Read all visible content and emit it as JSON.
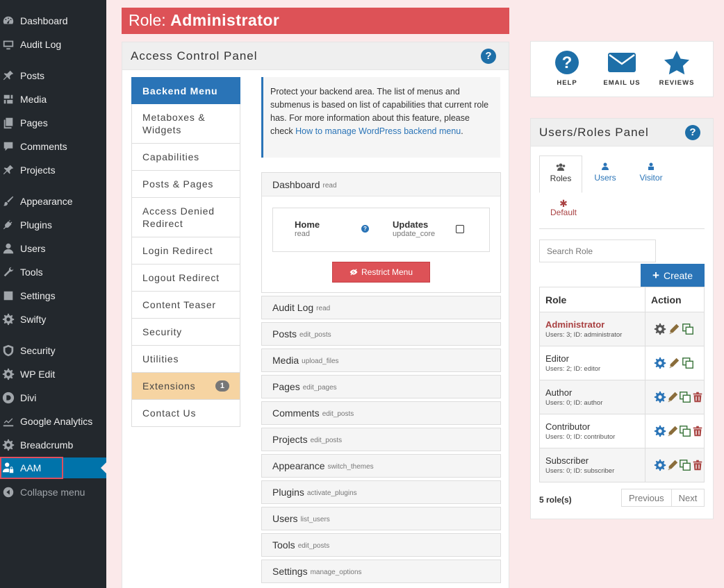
{
  "sidebar": {
    "items": [
      {
        "label": "Dashboard",
        "icon": "dashboard-icon"
      },
      {
        "label": "Audit Log",
        "icon": "monitor-icon"
      },
      {
        "label": "Posts",
        "icon": "pin-icon"
      },
      {
        "label": "Media",
        "icon": "media-icon"
      },
      {
        "label": "Pages",
        "icon": "pages-icon"
      },
      {
        "label": "Comments",
        "icon": "comment-icon"
      },
      {
        "label": "Projects",
        "icon": "pin-icon"
      },
      {
        "label": "Appearance",
        "icon": "brush-icon"
      },
      {
        "label": "Plugins",
        "icon": "plug-icon"
      },
      {
        "label": "Users",
        "icon": "user-icon"
      },
      {
        "label": "Tools",
        "icon": "wrench-icon"
      },
      {
        "label": "Settings",
        "icon": "settings-icon"
      },
      {
        "label": "Swifty",
        "icon": "gear-icon"
      },
      {
        "label": "Security",
        "icon": "shield-icon"
      },
      {
        "label": "WP Edit",
        "icon": "gear-icon"
      },
      {
        "label": "Divi",
        "icon": "divi-icon"
      },
      {
        "label": "Google Analytics",
        "icon": "chart-icon"
      },
      {
        "label": "Breadcrumb",
        "icon": "gear-icon"
      },
      {
        "label": "AAM",
        "icon": "user-lock-icon"
      },
      {
        "label": "Collapse menu",
        "icon": "collapse-icon"
      }
    ]
  },
  "role_header": {
    "prefix": "Role: ",
    "name": "Administrator"
  },
  "access_panel": {
    "title": "Access Control Panel",
    "features": [
      {
        "label": "Backend Menu"
      },
      {
        "label": "Metaboxes & Widgets"
      },
      {
        "label": "Capabilities"
      },
      {
        "label": "Posts & Pages"
      },
      {
        "label": "Access Denied Redirect"
      },
      {
        "label": "Login Redirect"
      },
      {
        "label": "Logout Redirect"
      },
      {
        "label": "Content Teaser"
      },
      {
        "label": "Security"
      },
      {
        "label": "Utilities"
      },
      {
        "label": "Extensions",
        "badge": "1"
      },
      {
        "label": "Contact Us"
      }
    ],
    "info_text": "Protect your backend area. The list of menus and submenus is based on list of capabilities that current role has. For more information about this feature, please check",
    "info_link": "How to manage WordPress backend menu",
    "info_end": ".",
    "menus": [
      {
        "name": "Dashboard",
        "cap": "read"
      },
      {
        "name": "Audit Log",
        "cap": "read"
      },
      {
        "name": "Posts",
        "cap": "edit_posts"
      },
      {
        "name": "Media",
        "cap": "upload_files"
      },
      {
        "name": "Pages",
        "cap": "edit_pages"
      },
      {
        "name": "Comments",
        "cap": "edit_posts"
      },
      {
        "name": "Projects",
        "cap": "edit_posts"
      },
      {
        "name": "Appearance",
        "cap": "switch_themes"
      },
      {
        "name": "Plugins",
        "cap": "activate_plugins"
      },
      {
        "name": "Users",
        "cap": "list_users"
      },
      {
        "name": "Tools",
        "cap": "edit_posts"
      },
      {
        "name": "Settings",
        "cap": "manage_options"
      }
    ],
    "submenus": [
      {
        "name": "Home",
        "cap": "read"
      },
      {
        "name": "Updates",
        "cap": "update_core"
      }
    ],
    "restrict_label": "Restrict Menu"
  },
  "support": {
    "items": [
      {
        "label": "HELP"
      },
      {
        "label": "EMAIL US"
      },
      {
        "label": "REVIEWS"
      }
    ]
  },
  "users_panel": {
    "title": "Users/Roles Panel",
    "tabs": [
      {
        "label": "Roles"
      },
      {
        "label": "Users"
      },
      {
        "label": "Visitor"
      },
      {
        "label": "Default"
      }
    ],
    "search_placeholder": "Search Role",
    "create_label": "Create",
    "columns": [
      "Role",
      "Action"
    ],
    "roles": [
      {
        "name": "Administrator",
        "meta": "Users: 3; ID: administrator"
      },
      {
        "name": "Editor",
        "meta": "Users: 2; ID: editor"
      },
      {
        "name": "Author",
        "meta": "Users: 0; ID: author"
      },
      {
        "name": "Contributor",
        "meta": "Users: 0; ID: contributor"
      },
      {
        "name": "Subscriber",
        "meta": "Users: 0; ID: subscriber"
      }
    ],
    "count": "5 role(s)",
    "prev": "Previous",
    "next": "Next"
  },
  "colors": {
    "accent": "#2a74b7",
    "danger": "#dd5257",
    "sidebar": "#23282d",
    "current": "#0073aa"
  }
}
